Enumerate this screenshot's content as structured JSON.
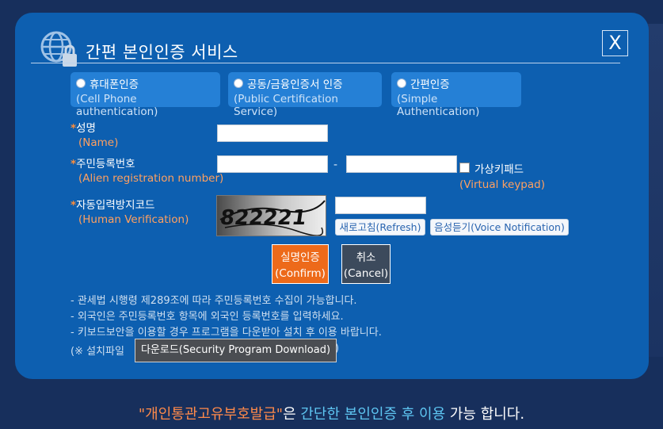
{
  "dialog": {
    "title": "간편 본인인증 서비스",
    "close_label": "X"
  },
  "methods": [
    {
      "label": "휴대폰인증",
      "sub": "(Cell Phone authentication)"
    },
    {
      "label": "공동/금융인증서 인증",
      "sub": "(Public Certification Service)"
    },
    {
      "label": "간편인증",
      "sub": "(Simple Authentication)"
    }
  ],
  "form": {
    "name_label": "성명",
    "name_sub": "(Name)",
    "reg_label": "주민등록번호",
    "reg_sub": "(Alien registration number)",
    "reg_dash": "-",
    "virtual_keypad_label": "가상키패드",
    "virtual_keypad_sub": "(Virtual keypad)",
    "captcha_label": "자동입력방지코드",
    "captcha_sub": "(Human Verification)",
    "captcha_text": "822221",
    "refresh_label": "새로고침(Refresh)",
    "voice_label": "음성듣기(Voice Notification)",
    "required_mark": "*"
  },
  "actions": {
    "confirm_line1": "실명인증",
    "confirm_line2": "(Confirm)",
    "cancel_line1": "취소",
    "cancel_line2": "(Cancel)"
  },
  "notes": [
    "- 관세법 시행령 제289조에 따라 주민등록번호 수집이 가능합니다.",
    "- 외국인은 주민등록번호 항목에 외국인 등록번호를 입력하세요.",
    "- 키보드보안을 이용할 경우 프로그램을 다운받아 설치 후 이용 바랍니다."
  ],
  "install": {
    "prefix": "(※ 설치파일",
    "suffix": ")",
    "download_label": "다운로드(Security Program Download)"
  },
  "footer": {
    "part1": "\"개인통관고유부호발급\"",
    "part2": "은 ",
    "part3": "간단한 본인인증 후 이용",
    "part4": " 가능 합니다."
  },
  "colors": {
    "background": "#172f5c",
    "dialog": "#0d5fb0",
    "method_box": "#2580d6",
    "accent_orange": "#ed6a1a",
    "footer_cyan": "#5ec6f2"
  }
}
